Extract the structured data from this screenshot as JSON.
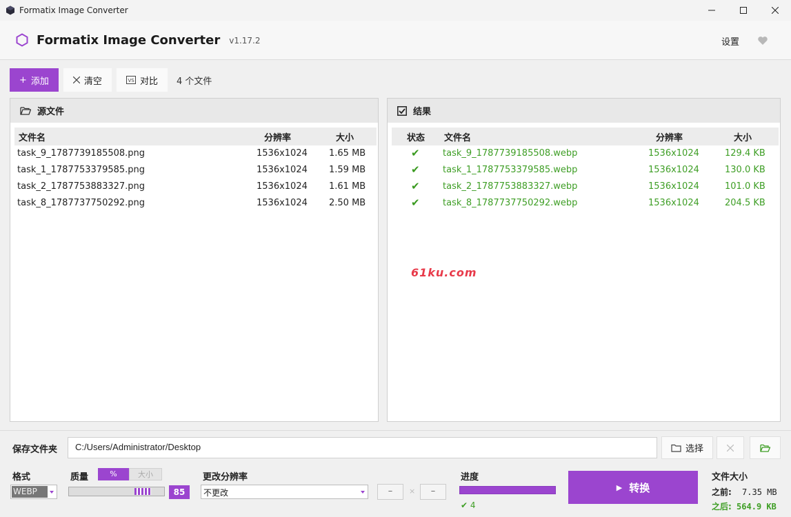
{
  "window": {
    "title": "Formatix Image Converter"
  },
  "header": {
    "app_name": "Formatix Image Converter",
    "version": "v1.17.2",
    "settings_label": "设置"
  },
  "toolbar": {
    "add_label": "添加",
    "clear_label": "清空",
    "compare_label": "对比",
    "file_count": "4 个文件"
  },
  "source_panel": {
    "title": "源文件",
    "columns": {
      "name": "文件名",
      "resolution": "分辨率",
      "size": "大小"
    },
    "rows": [
      {
        "name": "task_9_1787739185508.png",
        "resolution": "1536x1024",
        "size": "1.65 MB"
      },
      {
        "name": "task_1_1787753379585.png",
        "resolution": "1536x1024",
        "size": "1.59 MB"
      },
      {
        "name": "task_2_1787753883327.png",
        "resolution": "1536x1024",
        "size": "1.61 MB"
      },
      {
        "name": "task_8_1787737750292.png",
        "resolution": "1536x1024",
        "size": "2.50 MB"
      }
    ]
  },
  "result_panel": {
    "title": "结果",
    "columns": {
      "status": "状态",
      "name": "文件名",
      "resolution": "分辨率",
      "size": "大小"
    },
    "rows": [
      {
        "status": "✔",
        "name": "task_9_1787739185508.webp",
        "resolution": "1536x1024",
        "size": "129.4 KB"
      },
      {
        "status": "✔",
        "name": "task_1_1787753379585.webp",
        "resolution": "1536x1024",
        "size": "130.0 KB"
      },
      {
        "status": "✔",
        "name": "task_2_1787753883327.webp",
        "resolution": "1536x1024",
        "size": "101.0 KB"
      },
      {
        "status": "✔",
        "name": "task_8_1787737750292.webp",
        "resolution": "1536x1024",
        "size": "204.5 KB"
      }
    ]
  },
  "watermark": "61ku.com",
  "output": {
    "label": "保存文件夹",
    "path": "C:/Users/Administrator/Desktop",
    "choose_label": "选择"
  },
  "format": {
    "label": "格式",
    "value": "WEBP"
  },
  "quality": {
    "label": "质量",
    "mode_percent": "%",
    "mode_size": "大小",
    "value": "85",
    "level": 85
  },
  "resize": {
    "label": "更改分辨率",
    "value": "不更改",
    "width": "–",
    "height": "–",
    "separator": "×"
  },
  "progress": {
    "label": "进度",
    "done_count": "✔ 4",
    "fraction": 1.0
  },
  "convert": {
    "label": "转换"
  },
  "filesize": {
    "label": "文件大小",
    "before_label": "之前:",
    "before": "7.35 MB",
    "after_label": "之后:",
    "after": "564.9 KB"
  },
  "colors": {
    "accent": "#9b45cf",
    "success": "#3e9e25"
  }
}
